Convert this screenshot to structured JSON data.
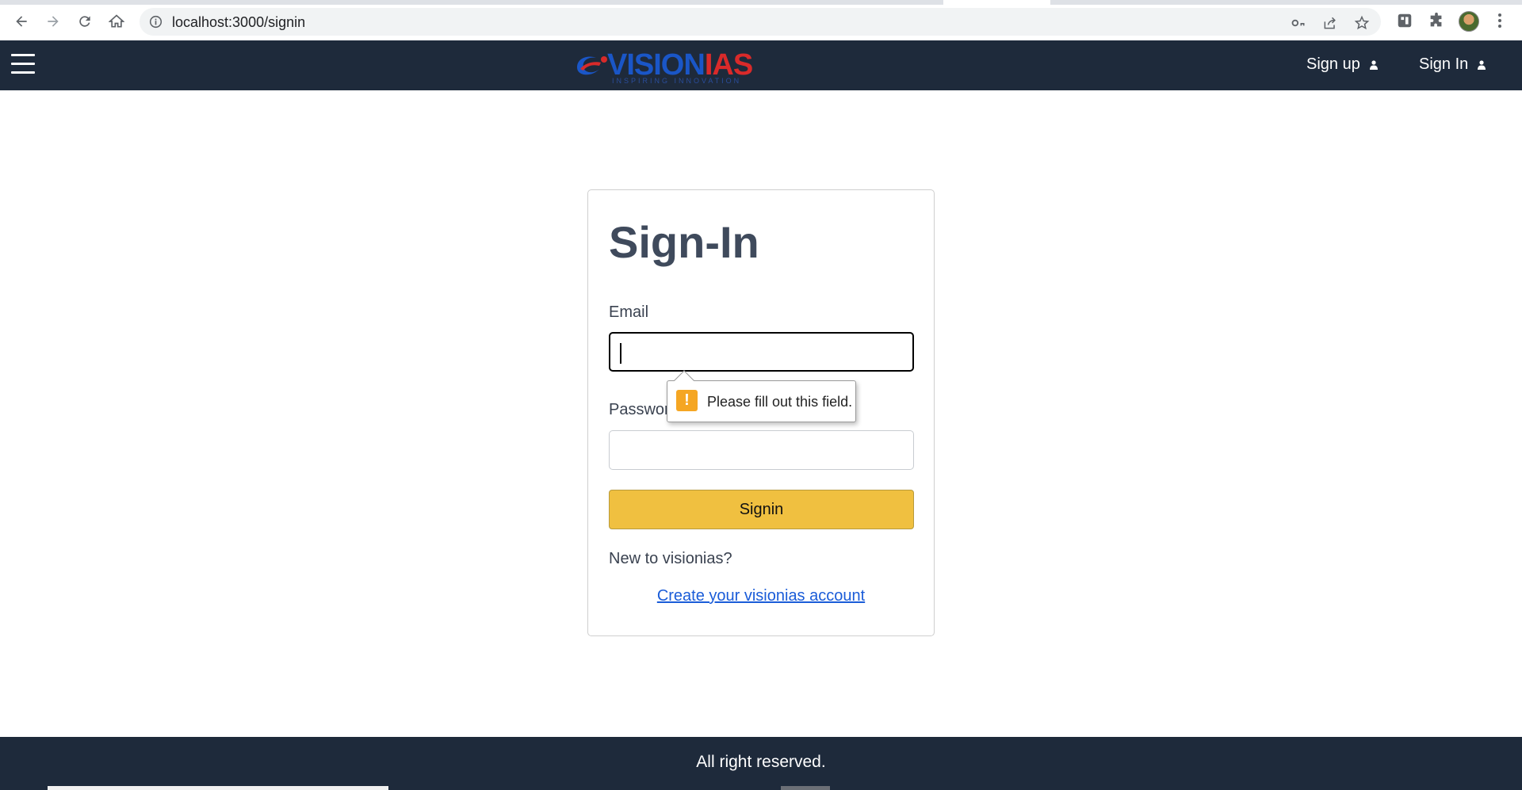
{
  "browser": {
    "url": "localhost:3000/signin",
    "nav_icons": [
      "back-arrow-icon",
      "forward-arrow-icon",
      "reload-icon",
      "home-icon"
    ],
    "omnibox_icons": [
      "key-icon",
      "share-icon",
      "star-icon"
    ],
    "extension_icons": [
      "extension-icon",
      "puzzle-icon"
    ]
  },
  "navbar": {
    "menu_icon": "hamburger-menu-icon",
    "logo": {
      "word_vision": "VISION",
      "word_ias": "IAS",
      "tagline": "INSPIRING INNOVATION"
    },
    "signup_label": "Sign up",
    "signin_label": "Sign In"
  },
  "form": {
    "title": "Sign-In",
    "email_label": "Email",
    "email_value": "",
    "password_label": "Password",
    "password_value": "",
    "submit_label": "Signin",
    "new_user_text": "New to visionias?",
    "create_account_link": "Create your visionias account"
  },
  "validation": {
    "message": "Please fill out this field.",
    "icon": "warning-icon",
    "icon_glyph": "!"
  },
  "footer": {
    "text": "All right reserved."
  },
  "colors": {
    "nav_bg": "#1e2a3b",
    "button_bg": "#f0c040",
    "link": "#1a5cd8",
    "heading": "#3f4a5c"
  }
}
